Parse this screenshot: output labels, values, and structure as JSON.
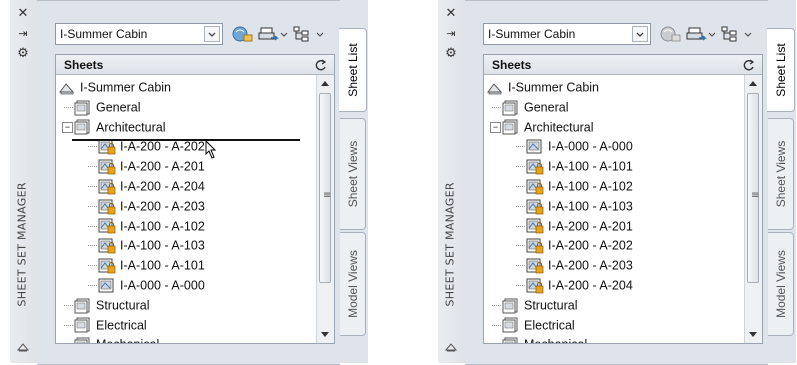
{
  "palette_title": "SHEET SET MANAGER",
  "icons": {
    "close": "close-icon",
    "autohide": "autohide-icon",
    "properties": "properties-icon",
    "sheet": "sheet-icon",
    "locked_sheet": "locked-sheet-icon",
    "sheet_set": "sheet-set-icon"
  },
  "tabs": [
    "Sheet List",
    "Sheet Views",
    "Model Views"
  ],
  "colors": {
    "lock": "#e8a317",
    "drag_line": "#111111"
  },
  "panels": [
    {
      "id": "before",
      "combo_value": "I-Summer Cabin",
      "tree_header": "Sheets",
      "rows": [
        {
          "label": "I-Summer Cabin",
          "kind": "set",
          "toggle": ""
        },
        {
          "label": "General",
          "kind": "subset",
          "toggle": ""
        },
        {
          "label": "Architectural",
          "kind": "subset",
          "toggle": "−"
        },
        {
          "label": "I-A-200 - A-202",
          "kind": "locked",
          "toggle": ""
        },
        {
          "label": "I-A-200 - A-201",
          "kind": "locked",
          "toggle": ""
        },
        {
          "label": "I-A-200 - A-204",
          "kind": "locked",
          "toggle": ""
        },
        {
          "label": "I-A-200 - A-203",
          "kind": "locked",
          "toggle": ""
        },
        {
          "label": "I-A-100 - A-102",
          "kind": "locked",
          "toggle": ""
        },
        {
          "label": "I-A-100 - A-103",
          "kind": "locked",
          "toggle": ""
        },
        {
          "label": "I-A-100 - A-101",
          "kind": "locked",
          "toggle": ""
        },
        {
          "label": "I-A-000 - A-000",
          "kind": "sheet",
          "toggle": ""
        },
        {
          "label": "Structural",
          "kind": "subset",
          "toggle": ""
        },
        {
          "label": "Electrical",
          "kind": "subset",
          "toggle": ""
        },
        {
          "label": "Mechanical",
          "kind": "subset",
          "toggle": ""
        }
      ]
    },
    {
      "id": "after",
      "combo_value": "I-Summer Cabin",
      "tree_header": "Sheets",
      "rows": [
        {
          "label": "I-Summer Cabin",
          "kind": "set",
          "toggle": ""
        },
        {
          "label": "General",
          "kind": "subset",
          "toggle": ""
        },
        {
          "label": "Architectural",
          "kind": "subset",
          "toggle": "−"
        },
        {
          "label": "I-A-000 - A-000",
          "kind": "sheet",
          "toggle": ""
        },
        {
          "label": "I-A-100 - A-101",
          "kind": "locked",
          "toggle": ""
        },
        {
          "label": "I-A-100 - A-102",
          "kind": "locked",
          "toggle": ""
        },
        {
          "label": "I-A-100 - A-103",
          "kind": "locked",
          "toggle": ""
        },
        {
          "label": "I-A-200 - A-201",
          "kind": "locked",
          "toggle": ""
        },
        {
          "label": "I-A-200 - A-202",
          "kind": "locked",
          "toggle": ""
        },
        {
          "label": "I-A-200 - A-203",
          "kind": "locked",
          "toggle": ""
        },
        {
          "label": "I-A-200 - A-204",
          "kind": "locked",
          "toggle": ""
        },
        {
          "label": "Structural",
          "kind": "subset",
          "toggle": ""
        },
        {
          "label": "Electrical",
          "kind": "subset",
          "toggle": ""
        },
        {
          "label": "Mechanical",
          "kind": "subset",
          "toggle": ""
        }
      ]
    }
  ]
}
